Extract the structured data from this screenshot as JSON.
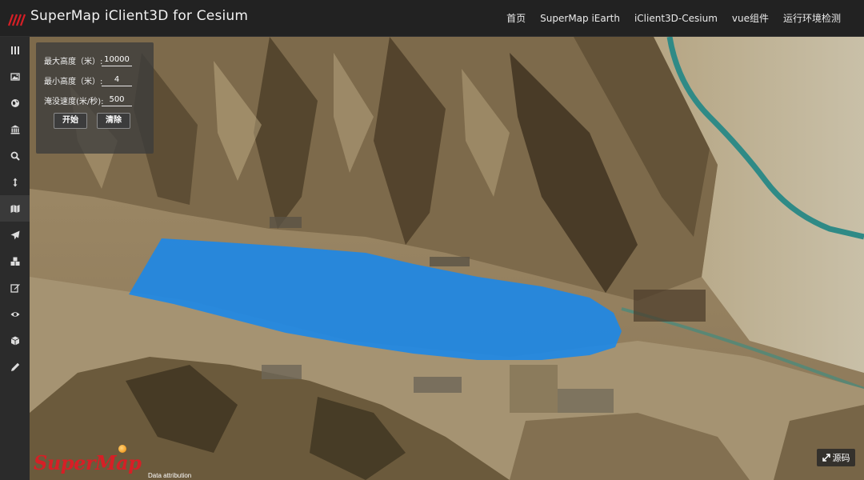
{
  "app": {
    "title": "SuperMap iClient3D for Cesium"
  },
  "nav": {
    "items": [
      {
        "label": "首页"
      },
      {
        "label": "SuperMap iEarth"
      },
      {
        "label": "iClient3D-Cesium"
      },
      {
        "label": "vue组件"
      },
      {
        "label": "运行环境检测"
      }
    ]
  },
  "sidebar": {
    "items": [
      {
        "icon": "menu-icon"
      },
      {
        "icon": "image-icon"
      },
      {
        "icon": "globe-icon"
      },
      {
        "icon": "bank-icon"
      },
      {
        "icon": "search-icon"
      },
      {
        "icon": "resize-vertical-icon"
      },
      {
        "icon": "map-icon",
        "active": true
      },
      {
        "icon": "paper-plane-icon"
      },
      {
        "icon": "cubes-icon"
      },
      {
        "icon": "edit-icon"
      },
      {
        "icon": "eye-icon"
      },
      {
        "icon": "cube-icon"
      },
      {
        "icon": "pencil-icon"
      }
    ]
  },
  "flood_panel": {
    "max_height_label": "最大高度（米）:",
    "max_height_value": "10000",
    "min_height_label": "最小高度（米）:",
    "min_height_value": "4",
    "speed_label": "淹没速度(米/秒):",
    "speed_value": "500",
    "start_label": "开始",
    "clear_label": "清除"
  },
  "footer": {
    "brand": "SuperMap",
    "attribution": "Data attribution",
    "source_label": "源码"
  },
  "colors": {
    "header_bg": "#222222",
    "sidebar_bg": "#2b2b2b",
    "flood_water": "#1e88e5",
    "brand_red": "#d61f26"
  }
}
